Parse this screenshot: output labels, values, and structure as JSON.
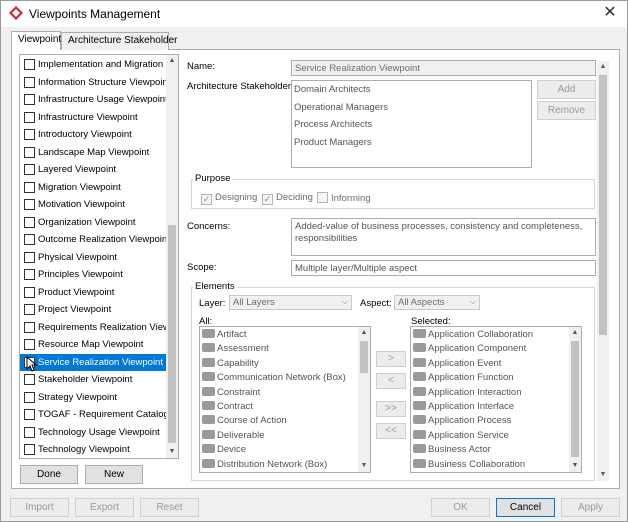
{
  "window": {
    "title": "Viewpoints Management",
    "close_glyph": "✕"
  },
  "tabs": [
    {
      "label": "Viewpoint",
      "active": true
    },
    {
      "label": "Architecture Stakeholder",
      "active": false
    }
  ],
  "viewpoint_list": {
    "items": [
      "Implementation and Migration ...",
      "Information Structure Viewpoint",
      "Infrastructure Usage Viewpoint",
      "Infrastructure Viewpoint",
      "Introductory Viewpoint",
      "Landscape Map Viewpoint",
      "Layered Viewpoint",
      "Migration Viewpoint",
      "Motivation Viewpoint",
      "Organization Viewpoint",
      "Outcome Realization Viewpoint",
      "Physical Viewpoint",
      "Principles Viewpoint",
      "Product Viewpoint",
      "Project Viewpoint",
      "Requirements Realization View...",
      "Resource Map Viewpoint",
      "Service Realization Viewpoint",
      "Stakeholder Viewpoint",
      "Strategy Viewpoint",
      "TOGAF - Requirement Catalog",
      "Technology Usage Viewpoint",
      "Technology Viewpoint"
    ],
    "selected": "Service Realization Viewpoint"
  },
  "list_buttons": {
    "done": "Done",
    "new": "New"
  },
  "form": {
    "name_label": "Name:",
    "name_value": "Service Realization Viewpoint",
    "stakeholders_label": "Architecture Stakeholders:",
    "stakeholders": [
      "Domain Architects",
      "Operational Managers",
      "Process Architects",
      "Product Managers"
    ],
    "add_label": "Add",
    "remove_label": "Remove",
    "purpose_title": "Purpose",
    "purpose": [
      {
        "label": "Designing",
        "checked": true
      },
      {
        "label": "Deciding",
        "checked": true
      },
      {
        "label": "Informing",
        "checked": false
      }
    ],
    "concerns_label": "Concerns:",
    "concerns_value": "Added-value of business processes, consistency and completeness, responsibilities",
    "scope_label": "Scope:",
    "scope_value": "Multiple layer/Multiple aspect",
    "elements_title": "Elements",
    "layer_label": "Layer:",
    "layer_value": "All Layers",
    "aspect_label": "Aspect:",
    "aspect_value": "All Aspects",
    "all_label": "All:",
    "selected_label": "Selected:",
    "all_items": [
      "Artifact",
      "Assessment",
      "Capability",
      "Communication Network (Box)",
      "Constraint",
      "Contract",
      "Course of Action",
      "Deliverable",
      "Device",
      "Distribution Network (Box)"
    ],
    "selected_items": [
      "Application Collaboration",
      "Application Component",
      "Application Event",
      "Application Function",
      "Application Interaction",
      "Application Interface",
      "Application Process",
      "Application Service",
      "Business Actor",
      "Business Collaboration"
    ],
    "move_buttons": [
      ">",
      "<",
      ">>",
      "<<"
    ]
  },
  "footer": {
    "import": "Import",
    "export": "Export",
    "reset": "Reset",
    "ok": "OK",
    "cancel": "Cancel",
    "apply": "Apply"
  },
  "colors": {
    "selection": "#0078d7",
    "brand_icon": "#c8282e"
  }
}
